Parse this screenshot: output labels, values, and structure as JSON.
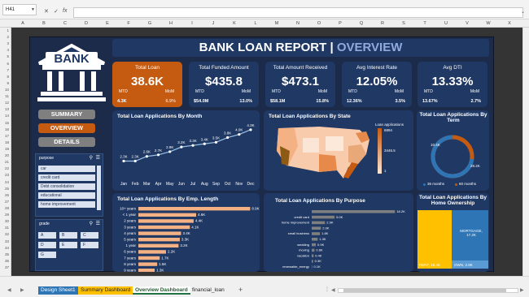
{
  "formula_bar": {
    "name_box": "H41",
    "fx": "fx"
  },
  "columns": [
    "A",
    "B",
    "C",
    "D",
    "E",
    "F",
    "G",
    "H",
    "I",
    "J",
    "K",
    "L",
    "M",
    "N",
    "O",
    "P",
    "Q",
    "R",
    "S",
    "T",
    "U",
    "V",
    "W",
    "X"
  ],
  "rows": [
    "1",
    "2",
    "3",
    "4",
    "5",
    "6",
    "7",
    "8",
    "9",
    "10",
    "11",
    "12",
    "13",
    "14",
    "15",
    "16",
    "17",
    "18",
    "19",
    "20",
    "21",
    "22",
    "23",
    "24",
    "25",
    "26",
    "27",
    "28",
    "29",
    "30",
    "31",
    "32",
    "33",
    "34",
    "35",
    "36",
    "37"
  ],
  "header": {
    "title_main": "BANK LOAN REPORT | ",
    "title_accent": "OVERVIEW",
    "bank_text": "BANK"
  },
  "nav": {
    "summary": "SUMMARY",
    "overview": "OVERVIEW",
    "details": "DETAILS"
  },
  "kpis": [
    {
      "title": "Total Loan",
      "value": "38.6K",
      "mtd_label": "MTD",
      "mom_label": "MoM",
      "mtd": "4.3K",
      "mom": "6.9%"
    },
    {
      "title": "Total Funded Amount",
      "value": "$435.8",
      "mtd_label": "MTD",
      "mom_label": "MoM",
      "mtd": "$54.0M",
      "mom": "13.0%"
    },
    {
      "title": "Total Amount Received",
      "value": "$473.1",
      "mtd_label": "MTD",
      "mom_label": "MoM",
      "mtd": "$58.1M",
      "mom": "15.8%"
    },
    {
      "title": "Avg Interest Rate",
      "value": "12.05%",
      "mtd_label": "MTD",
      "mom_label": "MoM",
      "mtd": "12.36%",
      "mom": "3.5%"
    },
    {
      "title": "Avg DTI",
      "value": "13.33%",
      "mtd_label": "MTD",
      "mom_label": "MoM",
      "mtd": "13.67%",
      "mom": "2.7%"
    }
  ],
  "slicers": {
    "purpose": {
      "title": "purpose",
      "items": [
        "car",
        "credit card",
        "Debt consolidation",
        "educational",
        "home improvement"
      ]
    },
    "grade": {
      "title": "grade",
      "items": [
        "A",
        "B",
        "C",
        "D",
        "E",
        "F",
        "G"
      ]
    }
  },
  "charts": {
    "month": {
      "title": "Total Loan Applications By Month"
    },
    "state": {
      "title": "Total Loan Applications By State",
      "legend_title": "Loan applications",
      "legend_max": "6894",
      "legend_mid": "3446.5",
      "legend_min": "1"
    },
    "term": {
      "title": "Total Loan Applications By Term",
      "legend_36": "36 months",
      "legend_60": "60 months"
    },
    "emp": {
      "title": "Total Loan Applications By Emp. Length"
    },
    "purpose": {
      "title": "Total Loan Applications By Purpose"
    },
    "home": {
      "title": "Total Loan Applications By Home Ownership",
      "rent_label": "RENT, 18.4K",
      "mortgage_label": "MORTGAGE, 17.2K",
      "own_label": "OWN, 2.8K"
    }
  },
  "chart_data": [
    {
      "type": "line",
      "title": "Total Loan Applications By Month",
      "categories": [
        "Jan",
        "Feb",
        "Mar",
        "Apr",
        "May",
        "Jun",
        "Jul",
        "Aug",
        "Sep",
        "Oct",
        "Nov",
        "Dec"
      ],
      "values": [
        2.3,
        2.3,
        2.6,
        2.7,
        2.9,
        3.2,
        3.3,
        3.4,
        3.5,
        3.8,
        4.0,
        4.3
      ],
      "labels": [
        "2.3K",
        "2.3K",
        "2.6K",
        "2.7K",
        "2.9K",
        "3.2K",
        "3.3K",
        "3.4K",
        "3.5K",
        "3.8K",
        "4.0K",
        "4.3K"
      ]
    },
    {
      "type": "pie",
      "title": "Total Loan Applications By Term",
      "categories": [
        "36 months",
        "60 months"
      ],
      "values": [
        28.2,
        10.4
      ],
      "labels": [
        "28.2K",
        "10.4K"
      ]
    },
    {
      "type": "bar",
      "title": "Total Loan Applications By Emp. Length",
      "categories": [
        "10+ years",
        "< 1 year",
        "2 years",
        "3 years",
        "4 years",
        "5 years",
        "1 year",
        "6 years",
        "7 years",
        "8 years",
        "9 years"
      ],
      "values": [
        8.9,
        4.6,
        4.4,
        4.1,
        3.4,
        3.3,
        3.2,
        2.2,
        1.7,
        1.5,
        1.3
      ],
      "labels": [
        "8.9K",
        "4.6K",
        "4.4K",
        "4.1K",
        "3.4K",
        "3.3K",
        "3.2K",
        "2.2K",
        "1.7K",
        "1.5K",
        "1.3K"
      ]
    },
    {
      "type": "bar",
      "title": "Total Loan Applications By Purpose",
      "categories": [
        "",
        "credit card",
        "home improvement",
        "",
        "small business",
        "",
        "wedding",
        "moving",
        "vacation",
        "",
        "renewable_energy"
      ],
      "values": [
        18.2,
        5.0,
        2.9,
        2.0,
        1.8,
        1.3,
        0.9,
        0.6,
        0.4,
        0.3,
        0.1
      ],
      "labels": [
        "18.2K",
        "5.0K",
        "2.9K",
        "2.0K",
        "1.8K",
        "1.3K",
        "0.9K",
        "0.6K",
        "0.4K",
        "0.3K",
        "0.1K"
      ]
    },
    {
      "type": "area",
      "title": "Total Loan Applications By Home Ownership",
      "categories": [
        "RENT",
        "MORTGAGE",
        "OWN"
      ],
      "values": [
        18.4,
        17.2,
        2.8
      ]
    }
  ],
  "sheet_tabs": [
    "Design Sheet1",
    "Summary Dashboard",
    "Overview Dashboard",
    "financial_loan"
  ],
  "colors": {
    "orange": "#c55a11",
    "navy": "#1f3864",
    "bg": "#1c2b4a",
    "blue_accent": "#2e75b6",
    "peach": "#f4b183",
    "yellow": "#ffc000"
  }
}
